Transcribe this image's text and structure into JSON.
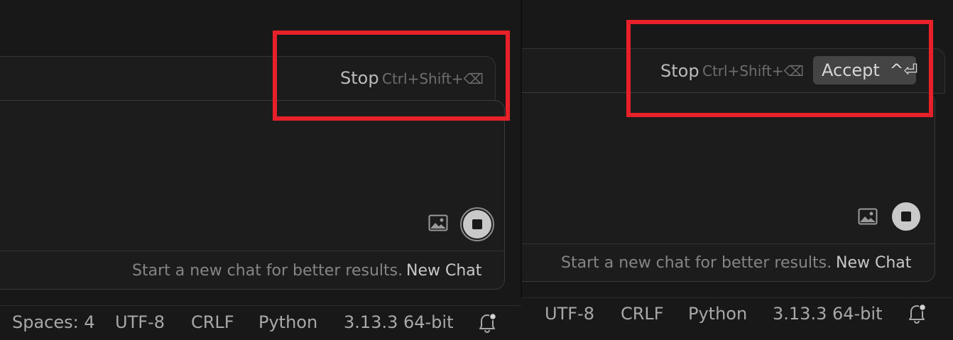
{
  "left": {
    "stop_label": "Stop",
    "stop_shortcut": "Ctrl+Shift+⌫",
    "hint": "Start a new chat for better results.",
    "new_chat": "New Chat",
    "status": {
      "spaces": "Spaces: 4",
      "encoding": "UTF-8",
      "eol": "CRLF",
      "language": "Python",
      "interpreter": "3.13.3 64-bit"
    }
  },
  "right": {
    "stop_label": "Stop",
    "stop_shortcut": "Ctrl+Shift+⌫",
    "accept_label": "Accept",
    "accept_shortcut": "^⏎",
    "hint": "Start a new chat for better results.",
    "new_chat": "New Chat",
    "status": {
      "encoding": "UTF-8",
      "eol": "CRLF",
      "language": "Python",
      "interpreter": "3.13.3 64-bit"
    }
  },
  "colors": {
    "background": "#181818",
    "highlight": "#e8202a",
    "accept_bg": "#444444",
    "stop_button": "#c9c9c9"
  },
  "icons": [
    "image-icon",
    "stop-square-icon",
    "bell-icon"
  ]
}
